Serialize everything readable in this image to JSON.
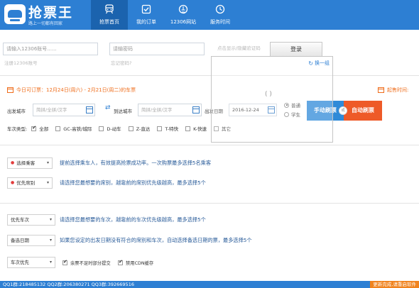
{
  "app": {
    "title": "抢票王",
    "subtitle": "路上一切都有回家"
  },
  "nav": [
    {
      "label": "抢票首页",
      "icon": "train-icon",
      "active": true
    },
    {
      "label": "我的订单",
      "icon": "order-check-icon",
      "active": false
    },
    {
      "label": "12306网站",
      "icon": "globe-icon",
      "active": false
    },
    {
      "label": "服务时间",
      "icon": "clock-icon",
      "active": false
    }
  ],
  "login": {
    "username_placeholder": "请输入12306账号......",
    "password_placeholder": "请输密码",
    "captcha_hint": "点击显示/隐藏验证码",
    "login_button": "登录",
    "register_link": "注册12306账号",
    "forgot_link": "忘记密码?"
  },
  "captcha": {
    "refresh_label": "换一组",
    "loading": "( )"
  },
  "query": {
    "today_text": "今日可订票：12月24日(周六) - 2月21日(周二)的车票",
    "alarm_label": "起售时间:",
    "from_label": "出发城市",
    "from_placeholder": "简拼/全拼/汉字",
    "to_label": "到达城市",
    "to_placeholder": "简拼/全拼/汉字",
    "date_label": "出发日期",
    "date_value": "2016-12-24",
    "ticket_types": [
      {
        "label": "普通",
        "checked": true
      },
      {
        "label": "学生",
        "checked": false
      }
    ],
    "manual_button": "手动刷票",
    "or_text": "或",
    "auto_button": "自动刷票",
    "train_type_label": "车次类型:",
    "train_types": [
      {
        "label": "全部",
        "checked": true
      },
      {
        "label": "GC-高铁/城际",
        "checked": false
      },
      {
        "label": "D-动车",
        "checked": false
      },
      {
        "label": "Z-直达",
        "checked": false
      },
      {
        "label": "T-特快",
        "checked": false
      },
      {
        "label": "K-快速",
        "checked": false
      },
      {
        "label": "其它",
        "checked": false
      }
    ]
  },
  "options": {
    "passenger": {
      "button": "选择乘客",
      "desc": "提前选择乘车人，有效提高抢票成功率。一次购票最多选择5名乘客"
    },
    "seat": {
      "button": "优先席别",
      "desc": "请选择您最想要的席别，越靠前的席别优先级越高，最多选择5个"
    },
    "train": {
      "button": "优先车次",
      "desc": "请选择您最想要的车次，越靠前的车次优先级越高，最多选择5个"
    },
    "backup_date": {
      "button": "备选日期",
      "desc": "如果您设定的出发日期没有符合的席别和车次，自动选择备选日期的票，最多选择5个"
    },
    "priority": {
      "select": "车次优先",
      "partial_submit": "余票不足时部分提交",
      "disable_cdn": "禁用CDN缓存"
    }
  },
  "footer": {
    "qq": "QQ1群:218485132  QQ2群:206380271  QQ3群:392669516",
    "right": "更新完成,请重启软件"
  },
  "colors": {
    "brand": "#2d7fd3",
    "accent_orange": "#ef6c1a",
    "auto_btn": "#ee5a28"
  }
}
